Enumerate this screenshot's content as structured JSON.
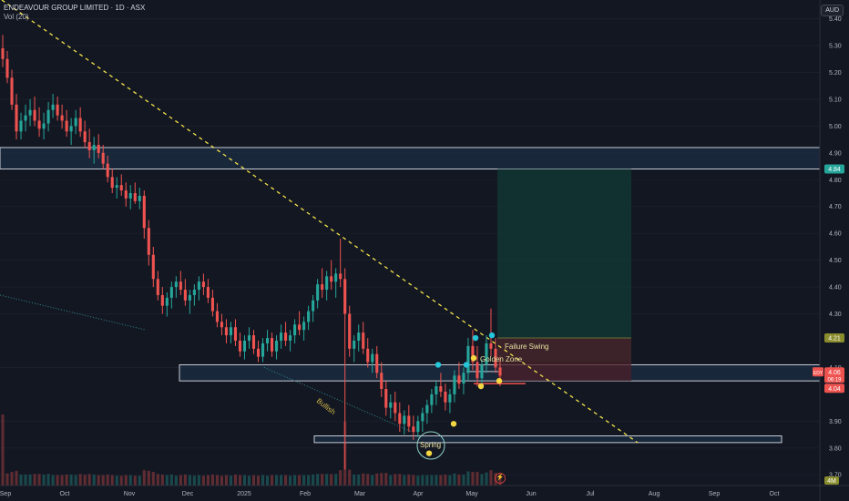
{
  "header": {
    "symbol": "ENDEAVOUR GROUP LIMITED · 1D · ASX",
    "volume_indicator": "Vol (20)"
  },
  "currency": "AUD",
  "colors": {
    "background": "#131722",
    "up": "#26a69a",
    "down": "#ef5350",
    "trendline": "#f3e24a",
    "zone_fill": "#1f3550",
    "zone_stroke": "#c8ccd4",
    "target_fill": "#123a36",
    "stop_fill": "#4a1f27",
    "marker_teal": "#26c6da",
    "marker_yellow": "#f5d742",
    "spring_circle": "#8fd3c7"
  },
  "chart_data": {
    "type": "candlestick",
    "x_ticks": [
      "Sep",
      "Oct",
      "Nov",
      "Dec",
      "2025",
      "Feb",
      "Mar",
      "Apr",
      "May",
      "Jun",
      "Jul",
      "Aug",
      "Sep",
      "Oct"
    ],
    "y_ticks": [
      "5.40",
      "5.30",
      "5.20",
      "5.10",
      "5.00",
      "4.90",
      "4.80",
      "4.70",
      "4.60",
      "4.50",
      "4.40",
      "4.30",
      "4.10",
      "3.90",
      "3.80",
      "3.70"
    ],
    "ylim": [
      3.66,
      5.47
    ],
    "price_labels": [
      {
        "text": "4.84",
        "value": 4.84,
        "color": "#26a69a"
      },
      {
        "text": "4.21",
        "value": 4.21,
        "color": "#8a8d2e"
      },
      {
        "text": "EDY",
        "value": 4.07,
        "color": "#ef5350"
      },
      {
        "text": "4.06",
        "value": 4.07,
        "color": "#ef5350"
      },
      {
        "text": "06:19",
        "value": 4.07,
        "color": "#ef5350"
      },
      {
        "text": "4.04",
        "value": 4.04,
        "color": "#ef5350"
      }
    ],
    "volume_label": "4M",
    "annotations": [
      "Failure Swing",
      "Golden Zone",
      "Bullish",
      "Spring"
    ],
    "zones": [
      {
        "name": "resistance-zone",
        "low": 4.84,
        "high": 4.92
      },
      {
        "name": "golden-support-zone",
        "low": 4.05,
        "high": 4.11
      },
      {
        "name": "spring-zone",
        "low": 3.82,
        "high": 3.845
      }
    ],
    "position": {
      "entry": 4.12,
      "target": 4.84,
      "stop": 4.05
    },
    "trendline": {
      "from": [
        "2024-09-01",
        5.47
      ],
      "to": [
        "2025-07-26",
        3.82
      ]
    },
    "ohlc": [
      [
        5.29,
        5.34,
        5.22,
        5.25
      ],
      [
        5.25,
        5.28,
        5.16,
        5.18
      ],
      [
        5.18,
        5.21,
        5.06,
        5.08
      ],
      [
        5.08,
        5.12,
        4.95,
        4.98
      ],
      [
        4.98,
        5.05,
        4.95,
        5.02
      ],
      [
        5.02,
        5.08,
        4.98,
        5.04
      ],
      [
        5.04,
        5.1,
        5.0,
        5.06
      ],
      [
        5.06,
        5.11,
        5.0,
        5.02
      ],
      [
        5.02,
        5.07,
        4.96,
        4.99
      ],
      [
        4.99,
        5.05,
        4.95,
        5.01
      ],
      [
        5.01,
        5.09,
        4.98,
        5.06
      ],
      [
        5.06,
        5.12,
        5.03,
        5.08
      ],
      [
        5.08,
        5.11,
        5.02,
        5.04
      ],
      [
        5.04,
        5.08,
        4.99,
        5.02
      ],
      [
        5.02,
        5.06,
        4.96,
        4.98
      ],
      [
        4.98,
        5.03,
        4.93,
        5.0
      ],
      [
        5.0,
        5.06,
        4.97,
        5.03
      ],
      [
        5.03,
        5.07,
        4.96,
        4.98
      ],
      [
        4.98,
        5.02,
        4.92,
        4.94
      ],
      [
        4.94,
        4.99,
        4.88,
        4.91
      ],
      [
        4.91,
        4.96,
        4.86,
        4.93
      ],
      [
        4.93,
        4.97,
        4.88,
        4.9
      ],
      [
        4.9,
        4.93,
        4.84,
        4.86
      ],
      [
        4.86,
        4.89,
        4.79,
        4.81
      ],
      [
        4.81,
        4.84,
        4.75,
        4.77
      ],
      [
        4.77,
        4.81,
        4.73,
        4.78
      ],
      [
        4.78,
        4.82,
        4.74,
        4.76
      ],
      [
        4.76,
        4.79,
        4.7,
        4.73
      ],
      [
        4.73,
        4.78,
        4.69,
        4.75
      ],
      [
        4.75,
        4.79,
        4.71,
        4.72
      ],
      [
        4.72,
        4.77,
        4.69,
        4.74
      ],
      [
        4.74,
        4.76,
        4.58,
        4.62
      ],
      [
        4.62,
        4.65,
        4.48,
        4.52
      ],
      [
        4.52,
        4.55,
        4.4,
        4.43
      ],
      [
        4.43,
        4.46,
        4.35,
        4.37
      ],
      [
        4.37,
        4.4,
        4.3,
        4.33
      ],
      [
        4.33,
        4.38,
        4.29,
        4.36
      ],
      [
        4.36,
        4.42,
        4.32,
        4.4
      ],
      [
        4.4,
        4.44,
        4.36,
        4.42
      ],
      [
        4.42,
        4.46,
        4.37,
        4.39
      ],
      [
        4.39,
        4.43,
        4.33,
        4.35
      ],
      [
        4.35,
        4.39,
        4.3,
        4.37
      ],
      [
        4.37,
        4.41,
        4.33,
        4.39
      ],
      [
        4.39,
        4.44,
        4.35,
        4.42
      ],
      [
        4.42,
        4.45,
        4.37,
        4.4
      ],
      [
        4.4,
        4.43,
        4.34,
        4.36
      ],
      [
        4.36,
        4.39,
        4.29,
        4.31
      ],
      [
        4.31,
        4.34,
        4.25,
        4.27
      ],
      [
        4.27,
        4.3,
        4.22,
        4.25
      ],
      [
        4.25,
        4.28,
        4.19,
        4.22
      ],
      [
        4.22,
        4.27,
        4.19,
        4.25
      ],
      [
        4.25,
        4.28,
        4.18,
        4.2
      ],
      [
        4.2,
        4.23,
        4.14,
        4.16
      ],
      [
        4.16,
        4.22,
        4.13,
        4.2
      ],
      [
        4.2,
        4.25,
        4.17,
        4.22
      ],
      [
        4.22,
        4.24,
        4.15,
        4.17
      ],
      [
        4.17,
        4.2,
        4.12,
        4.14
      ],
      [
        4.14,
        4.21,
        4.12,
        4.19
      ],
      [
        4.19,
        4.24,
        4.16,
        4.21
      ],
      [
        4.21,
        4.23,
        4.14,
        4.16
      ],
      [
        4.16,
        4.22,
        4.13,
        4.2
      ],
      [
        4.2,
        4.26,
        4.17,
        4.23
      ],
      [
        4.23,
        4.27,
        4.18,
        4.2
      ],
      [
        4.2,
        4.24,
        4.16,
        4.22
      ],
      [
        4.22,
        4.28,
        4.19,
        4.26
      ],
      [
        4.26,
        4.31,
        4.22,
        4.24
      ],
      [
        4.24,
        4.29,
        4.2,
        4.27
      ],
      [
        4.27,
        4.33,
        4.24,
        4.31
      ],
      [
        4.31,
        4.37,
        4.27,
        4.35
      ],
      [
        4.35,
        4.43,
        4.32,
        4.41
      ],
      [
        4.41,
        4.47,
        4.36,
        4.39
      ],
      [
        4.39,
        4.46,
        4.35,
        4.44
      ],
      [
        4.44,
        4.5,
        4.39,
        4.42
      ],
      [
        4.42,
        4.47,
        4.36,
        4.45
      ],
      [
        4.45,
        4.58,
        4.4,
        4.43
      ],
      [
        4.43,
        4.47,
        3.72,
        4.3
      ],
      [
        4.3,
        4.33,
        4.14,
        4.17
      ],
      [
        4.17,
        4.22,
        4.12,
        4.2
      ],
      [
        4.2,
        4.26,
        4.16,
        4.23
      ],
      [
        4.23,
        4.27,
        4.15,
        4.17
      ],
      [
        4.17,
        4.21,
        4.1,
        4.12
      ],
      [
        4.12,
        4.17,
        4.08,
        4.15
      ],
      [
        4.15,
        4.18,
        4.06,
        4.08
      ],
      [
        4.08,
        4.12,
        3.99,
        4.02
      ],
      [
        4.02,
        4.05,
        3.92,
        3.95
      ],
      [
        3.95,
        4.0,
        3.91,
        3.97
      ],
      [
        3.97,
        4.01,
        3.9,
        3.93
      ],
      [
        3.93,
        3.97,
        3.86,
        3.89
      ],
      [
        3.89,
        3.94,
        3.85,
        3.92
      ],
      [
        3.92,
        3.96,
        3.86,
        3.88
      ],
      [
        3.88,
        3.92,
        3.83,
        3.86
      ],
      [
        3.86,
        3.92,
        3.84,
        3.9
      ],
      [
        3.9,
        3.95,
        3.86,
        3.93
      ],
      [
        3.93,
        3.98,
        3.89,
        3.96
      ],
      [
        3.96,
        4.02,
        3.93,
        4.0
      ],
      [
        4.0,
        4.05,
        3.96,
        4.03
      ],
      [
        4.03,
        4.08,
        3.99,
        4.01
      ],
      [
        4.01,
        4.04,
        3.94,
        3.97
      ],
      [
        3.97,
        4.02,
        3.93,
        4.0
      ],
      [
        4.0,
        4.09,
        3.97,
        4.07
      ],
      [
        4.07,
        4.12,
        4.02,
        4.04
      ],
      [
        4.04,
        4.1,
        4.0,
        4.08
      ],
      [
        4.08,
        4.21,
        4.05,
        4.18
      ],
      [
        4.18,
        4.24,
        4.09,
        4.12
      ],
      [
        4.12,
        4.18,
        4.03,
        4.06
      ],
      [
        4.06,
        4.13,
        4.02,
        4.11
      ],
      [
        4.11,
        4.22,
        4.08,
        4.19
      ],
      [
        4.19,
        4.32,
        4.14,
        4.17
      ],
      [
        4.17,
        4.21,
        4.08,
        4.1
      ],
      [
        4.1,
        4.14,
        4.03,
        4.07
      ]
    ]
  }
}
